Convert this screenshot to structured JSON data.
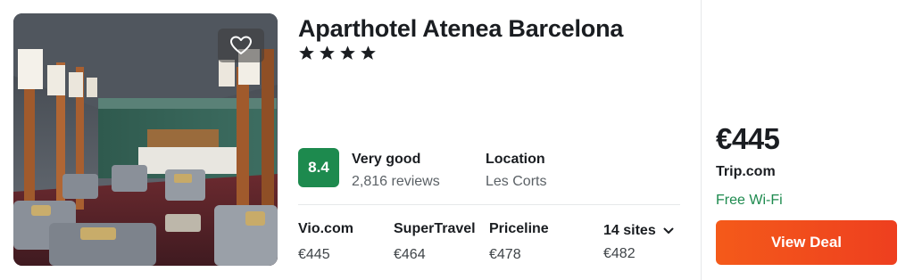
{
  "hotel": {
    "name": "Aparthotel Atenea Barcelona",
    "stars": 4,
    "rating": {
      "score": "8.4",
      "label": "Very good",
      "reviews": "2,816 reviews",
      "color": "#1d8a4e"
    },
    "location": {
      "label": "Location",
      "value": "Les Corts"
    }
  },
  "providers": [
    {
      "name": "Vio.com",
      "price": "€445"
    },
    {
      "name": "SuperTravel",
      "price": "€464"
    },
    {
      "name": "Priceline",
      "price": "€478"
    }
  ],
  "more_sites": {
    "label": "14 sites",
    "price": "€482",
    "icon": "chevron-down-icon"
  },
  "best_deal": {
    "price": "€445",
    "provider": "Trip.com",
    "perk": "Free Wi-Fi",
    "button_label": "View Deal",
    "button_color": "#f0471c"
  },
  "icons": {
    "favorite": "heart-icon",
    "star": "star-icon"
  }
}
